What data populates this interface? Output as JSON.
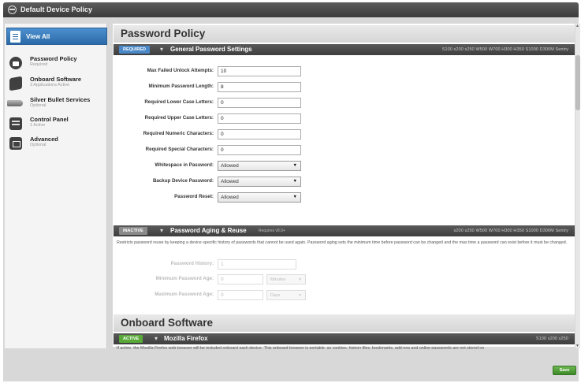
{
  "window": {
    "title": "Default Device Policy"
  },
  "sidebar": {
    "active": {
      "label": "View All"
    },
    "items": [
      {
        "label": "Password Policy",
        "sub": "Required"
      },
      {
        "label": "Onboard Software",
        "sub": "3 Applications Active"
      },
      {
        "label": "Silver Bullet Services",
        "sub": "Optional"
      },
      {
        "label": "Control Panel",
        "sub": "1 Active"
      },
      {
        "label": "Advanced",
        "sub": "Optional"
      }
    ]
  },
  "password_policy": {
    "title": "Password Policy",
    "general": {
      "badge": "REQUIRED",
      "title": "General Password Settings",
      "models": "S100 s200 s250 W500 W700 H300 H350 S1000 D300M Sentry",
      "fields": [
        {
          "label": "Max Failed Unlock Attempts:",
          "value": "10"
        },
        {
          "label": "Minimum Password Length:",
          "value": "8"
        },
        {
          "label": "Required Lower Case Letters:",
          "value": "0"
        },
        {
          "label": "Required Upper Case Letters:",
          "value": "0"
        },
        {
          "label": "Required Numeric Characters:",
          "value": "0"
        },
        {
          "label": "Required Special Characters:",
          "value": "0"
        }
      ],
      "selects": [
        {
          "label": "Whitespace in Password:",
          "value": "Allowed"
        },
        {
          "label": "Backup Device Password:",
          "value": "Allowed"
        },
        {
          "label": "Password Reset:",
          "value": "Allowed"
        }
      ]
    },
    "aging": {
      "badge": "INACTIVE",
      "title": "Password Aging & Reuse",
      "note": "Requires v8.0+",
      "models": "s200 s250 W500 W700 H300 H350 S1000 D300M Sentry",
      "description": "Restricts password reuse by keeping a device specific history of passwords that cannot be used again. Password aging sets the minimum time before password can be changed and the max time a password can exist before it must be changed.",
      "fields": [
        {
          "label": "Password History:",
          "value": "1"
        },
        {
          "label": "Minimum Password Age:",
          "value": "0",
          "unit": "Minutes"
        },
        {
          "label": "Maximum Password Age:",
          "value": "0",
          "unit": "Days"
        }
      ]
    }
  },
  "onboard": {
    "title": "Onboard Software",
    "firefox": {
      "badge": "ACTIVE",
      "title": "Mozilla Firefox",
      "models": "S100 s200 s250",
      "description": "If active, the Mozilla Firefox web browser will be included onboard each device. This onboard browser is portable, so cookies, history files, bookmarks, add-ons and online passwords are not stored on"
    }
  },
  "footer": {
    "save_label": "Save"
  },
  "colors": {
    "accent": "#2b6aa8",
    "header_bar": "#4a4a4a",
    "save": "#4f9e36"
  }
}
